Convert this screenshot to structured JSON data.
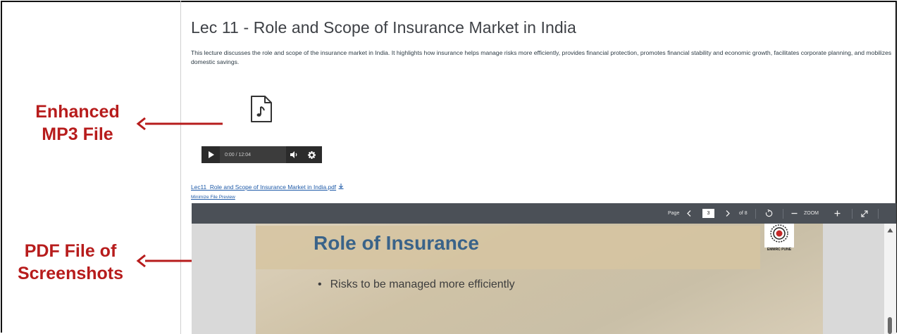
{
  "annotations": {
    "mp3_label": [
      "Enhanced",
      "MP3 File"
    ],
    "pdf_label": [
      "PDF File of",
      "Screenshots"
    ],
    "color": "#b71c1c"
  },
  "lecture": {
    "title": "Lec 11 - Role and Scope of Insurance Market in India",
    "description": "This lecture discusses the role and scope of the insurance market in India. It highlights how insurance helps manage risks more efficiently, provides financial protection, promotes financial stability and economic growth, facilitates corporate planning, and mobilizes domestic savings."
  },
  "audio_file": {
    "icon": "music-file-icon"
  },
  "audio_player": {
    "time": "0:00 / 12:04",
    "play_icon": "play-icon",
    "volume_icon": "volume-icon",
    "settings_icon": "gear-icon"
  },
  "pdf": {
    "file_link": "Lec11_Role and Scope of Insurance Market in India.pdf",
    "download_icon": "download-icon",
    "minimize_link": "Minimize File Preview"
  },
  "viewer_toolbar": {
    "page_label": "Page",
    "page_current": "3",
    "page_total": "of 8",
    "zoom_label": "ZOOM",
    "prev_icon": "chevron-left-icon",
    "next_icon": "chevron-right-icon",
    "rotate_icon": "rotate-icon",
    "zoom_out_icon": "minus-icon",
    "zoom_in_icon": "plus-icon",
    "fullscreen_icon": "expand-icon"
  },
  "slide": {
    "title": "Role of Insurance",
    "bullet": "Risks to be managed more efficiently",
    "logo_text": "EMMRC PUNE"
  },
  "colors": {
    "toolbar_bg": "#4b5057",
    "link": "#1e5aa8",
    "slide_title": "#3a6389"
  }
}
